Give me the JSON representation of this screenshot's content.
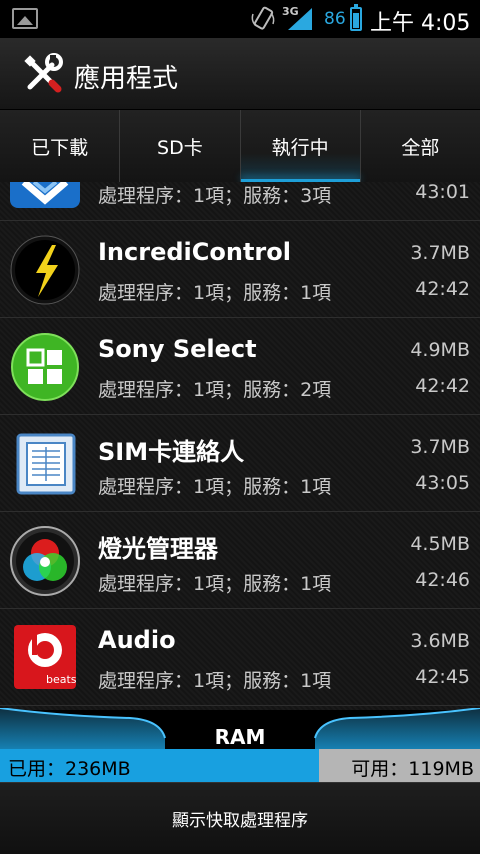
{
  "status_bar": {
    "network": "3G",
    "battery_percent": "86",
    "battery_level": 0.86,
    "time": "上午 4:05"
  },
  "action_bar": {
    "title": "應用程式",
    "icon": "tools-icon"
  },
  "tabs": [
    {
      "label": "已下載",
      "active": false
    },
    {
      "label": "SD卡",
      "active": false
    },
    {
      "label": "執行中",
      "active": true
    },
    {
      "label": "全部",
      "active": false
    }
  ],
  "apps": [
    {
      "name": "",
      "size": "",
      "detail": "處理程序：1項；服務：3項",
      "elapsed": "43:01",
      "icon": "partial-blue-app-icon"
    },
    {
      "name": "IncrediControl",
      "size": "3.7MB",
      "detail": "處理程序：1項；服務：1項",
      "elapsed": "42:42",
      "icon": "lightning-bolt-icon"
    },
    {
      "name": "Sony Select",
      "size": "4.9MB",
      "detail": "處理程序：1項；服務：2項",
      "elapsed": "42:42",
      "icon": "grid-squares-icon"
    },
    {
      "name": "SIM卡連絡人",
      "size": "3.7MB",
      "detail": "處理程序：1項；服務：1項",
      "elapsed": "43:05",
      "icon": "sim-card-contacts-icon"
    },
    {
      "name": "燈光管理器",
      "size": "4.5MB",
      "detail": "處理程序：1項；服務：1項",
      "elapsed": "42:46",
      "icon": "color-wheel-icon"
    },
    {
      "name": "Audio",
      "size": "3.6MB",
      "detail": "處理程序：1項；服務：1項",
      "elapsed": "42:45",
      "icon": "beats-audio-icon"
    }
  ],
  "ram": {
    "label": "RAM",
    "used_text": "已用：236MB",
    "free_text": "可用：119MB",
    "used_fraction": 0.665,
    "used_color": "#18a0e0"
  },
  "bottom_button": {
    "label": "顯示快取處理程序"
  },
  "colors": {
    "accent": "#1e9fd8",
    "battery": "#2aa8e0"
  }
}
